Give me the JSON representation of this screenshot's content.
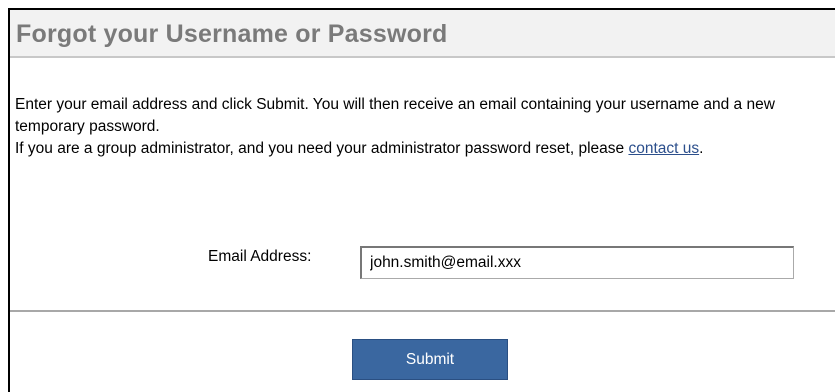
{
  "header": {
    "title": "Forgot your Username or Password"
  },
  "intro": {
    "line1": "Enter your email address and click Submit. You will then receive an email containing your username and a new temporary password.",
    "line2_prefix": "If you are a group administrator, and you need your administrator password reset, please ",
    "contact_link": "contact us",
    "line2_suffix": "."
  },
  "form": {
    "email_label": "Email Address:",
    "email_value": "john.smith@email.xxx",
    "submit_label": "Submit"
  }
}
